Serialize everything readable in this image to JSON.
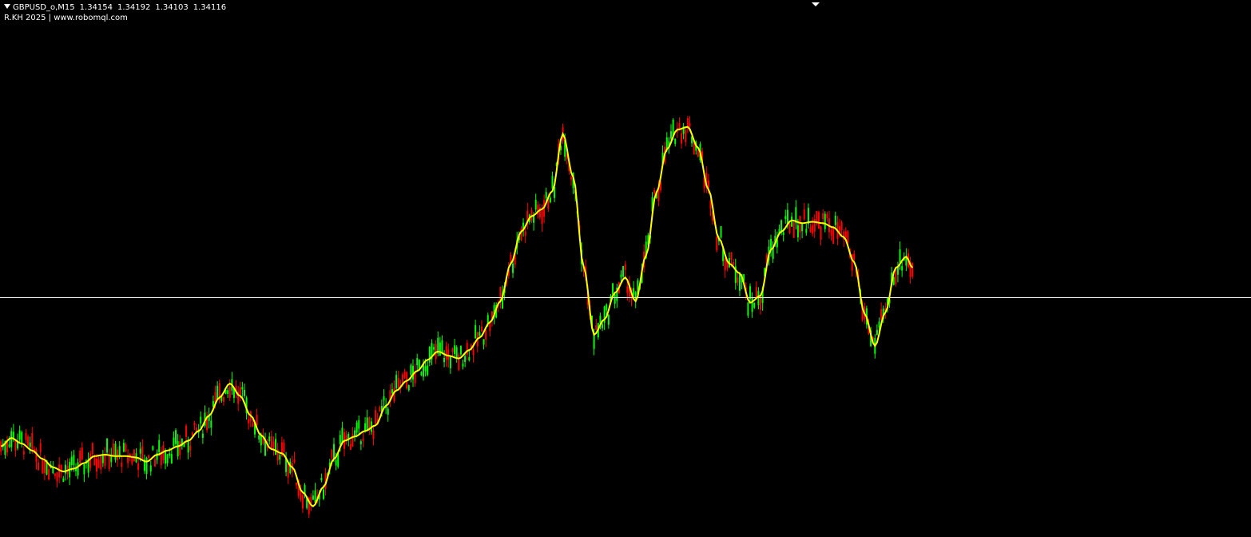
{
  "header": {
    "symbol": "GBPUSD_o,M15",
    "open": "1.34154",
    "high": "1.34192",
    "low": "1.34103",
    "close": "1.34116",
    "indicator_label": "R.KH 2025 | www.robomql.com"
  },
  "colors": {
    "background": "#000000",
    "bull": "#00ff00",
    "bear": "#ff0000",
    "indicator": "#ffff00",
    "price_line": "#ffffff",
    "text": "#ffffff"
  },
  "chart_data": {
    "type": "line",
    "y_domain": [
      1.324,
      1.3625
    ],
    "current_price": 1.34116,
    "anchors": [
      [
        0,
        1.3305
      ],
      [
        5,
        1.3311
      ],
      [
        10,
        1.3307
      ],
      [
        15,
        1.3302
      ],
      [
        20,
        1.3296
      ],
      [
        25,
        1.329
      ],
      [
        30,
        1.3287
      ],
      [
        35,
        1.3289
      ],
      [
        40,
        1.3293
      ],
      [
        45,
        1.3298
      ],
      [
        50,
        1.3299
      ],
      [
        55,
        1.3298
      ],
      [
        60,
        1.3298
      ],
      [
        65,
        1.3297
      ],
      [
        70,
        1.3294
      ],
      [
        75,
        1.3299
      ],
      [
        80,
        1.3302
      ],
      [
        85,
        1.3305
      ],
      [
        90,
        1.3309
      ],
      [
        95,
        1.3316
      ],
      [
        100,
        1.3327
      ],
      [
        105,
        1.334
      ],
      [
        110,
        1.335
      ],
      [
        115,
        1.3341
      ],
      [
        120,
        1.3327
      ],
      [
        125,
        1.3313
      ],
      [
        130,
        1.3303
      ],
      [
        135,
        1.33
      ],
      [
        140,
        1.329
      ],
      [
        145,
        1.3272
      ],
      [
        150,
        1.3262
      ],
      [
        155,
        1.3276
      ],
      [
        160,
        1.3296
      ],
      [
        165,
        1.3309
      ],
      [
        170,
        1.3312
      ],
      [
        175,
        1.3316
      ],
      [
        180,
        1.332
      ],
      [
        185,
        1.3334
      ],
      [
        190,
        1.3345
      ],
      [
        195,
        1.3352
      ],
      [
        200,
        1.3359
      ],
      [
        205,
        1.3367
      ],
      [
        210,
        1.3373
      ],
      [
        215,
        1.337
      ],
      [
        220,
        1.3368
      ],
      [
        225,
        1.3374
      ],
      [
        230,
        1.3383
      ],
      [
        235,
        1.3394
      ],
      [
        240,
        1.3409
      ],
      [
        245,
        1.3436
      ],
      [
        250,
        1.3459
      ],
      [
        255,
        1.347
      ],
      [
        260,
        1.3475
      ],
      [
        265,
        1.3488
      ],
      [
        270,
        1.3529
      ],
      [
        275,
        1.3498
      ],
      [
        280,
        1.3434
      ],
      [
        285,
        1.3385
      ],
      [
        290,
        1.3396
      ],
      [
        295,
        1.3415
      ],
      [
        300,
        1.3426
      ],
      [
        305,
        1.3409
      ],
      [
        310,
        1.3442
      ],
      [
        315,
        1.3487
      ],
      [
        320,
        1.3518
      ],
      [
        325,
        1.3532
      ],
      [
        330,
        1.3534
      ],
      [
        335,
        1.3519
      ],
      [
        340,
        1.3489
      ],
      [
        345,
        1.3454
      ],
      [
        350,
        1.3436
      ],
      [
        355,
        1.3429
      ],
      [
        360,
        1.3408
      ],
      [
        365,
        1.3413
      ],
      [
        370,
        1.3446
      ],
      [
        375,
        1.3459
      ],
      [
        380,
        1.3467
      ],
      [
        385,
        1.3465
      ],
      [
        390,
        1.3466
      ],
      [
        395,
        1.3465
      ],
      [
        400,
        1.3462
      ],
      [
        405,
        1.3455
      ],
      [
        410,
        1.3437
      ],
      [
        415,
        1.34
      ],
      [
        420,
        1.3377
      ],
      [
        425,
        1.3401
      ],
      [
        430,
        1.3433
      ],
      [
        435,
        1.3441
      ],
      [
        438,
        1.3433
      ]
    ],
    "ylabel": "",
    "xlabel": ""
  }
}
